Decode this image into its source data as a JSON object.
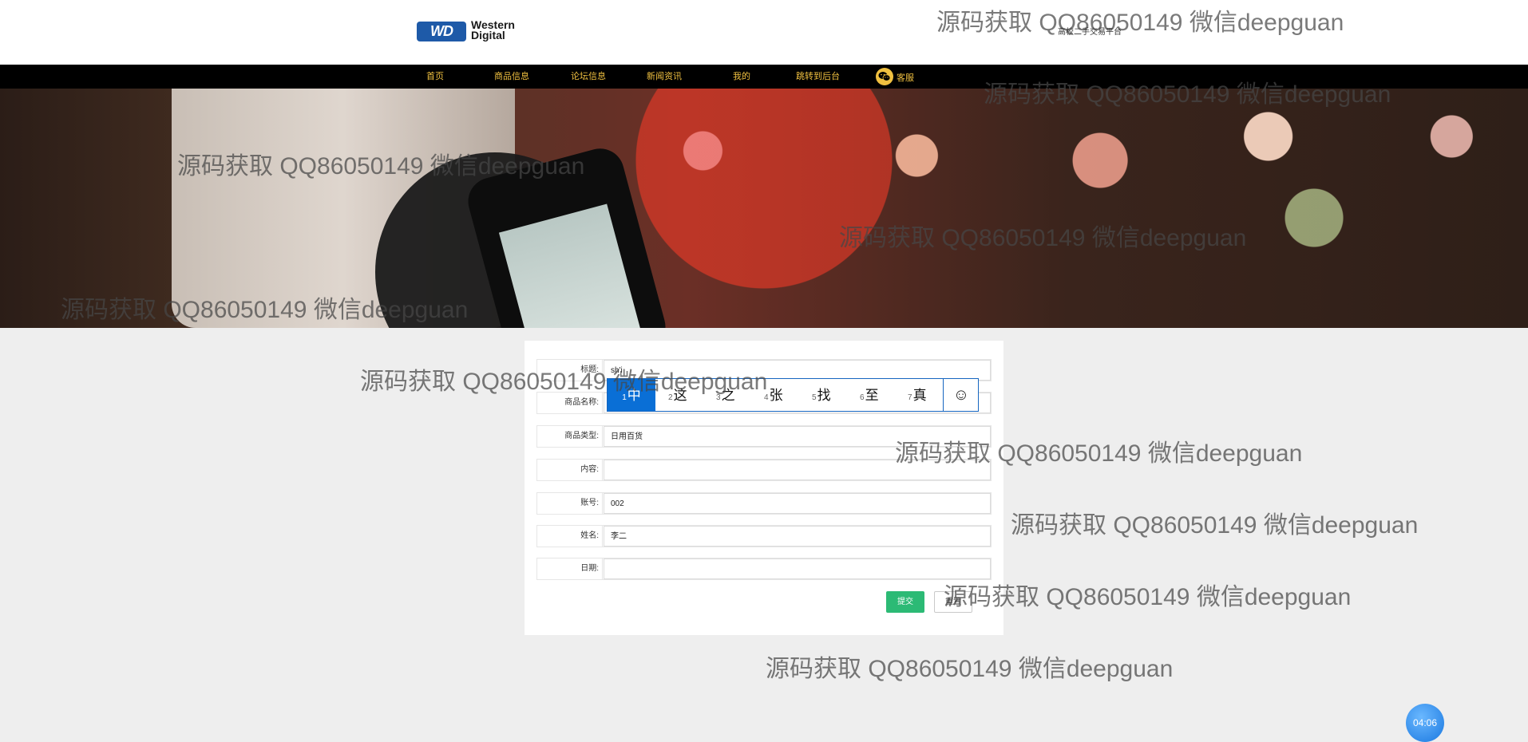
{
  "header": {
    "logo_badge": "WD",
    "logo_line1": "Western",
    "logo_line2": "Digital",
    "subtitle": "高校二手交易平台"
  },
  "nav": {
    "items": [
      "首页",
      "商品信息",
      "论坛信息",
      "新闻资讯",
      "我的",
      "跳转到后台"
    ],
    "service_label": "客服"
  },
  "form": {
    "rows": [
      {
        "label": "标题:",
        "value": "sh'i"
      },
      {
        "label": "商品名称:",
        "value": ""
      },
      {
        "label": "商品类型:",
        "value": "日用百货"
      },
      {
        "label": "内容:",
        "value": ""
      },
      {
        "label": "账号:",
        "value": "002"
      },
      {
        "label": "姓名:",
        "value": "李二"
      },
      {
        "label": "日期:",
        "value": ""
      }
    ],
    "submit_label": "提交",
    "reset_label": "重置"
  },
  "ime": {
    "candidates": [
      {
        "num": "1",
        "text": "中"
      },
      {
        "num": "2",
        "text": "这"
      },
      {
        "num": "3",
        "text": "之"
      },
      {
        "num": "4",
        "text": "张"
      },
      {
        "num": "5",
        "text": "找"
      },
      {
        "num": "6",
        "text": "至"
      },
      {
        "num": "7",
        "text": "真"
      }
    ],
    "emoji": "☺"
  },
  "timer": "04:06",
  "watermark_text": "源码获取 QQ86050149 微信deepguan",
  "colors": {
    "nav_bg": "#000000",
    "nav_text": "#f0c040",
    "submit_bg": "#2cba75",
    "ime_selected": "#0a6fd6"
  }
}
